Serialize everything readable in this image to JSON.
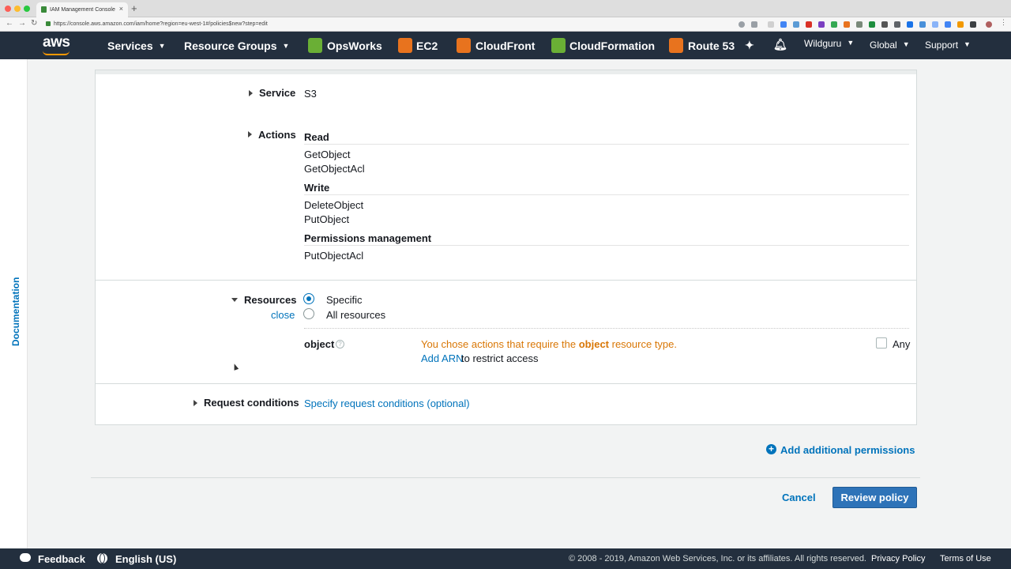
{
  "browser": {
    "tab_title": "IAM Management Console",
    "tab_close": "×",
    "new_tab": "+",
    "url": "https://console.aws.amazon.com/iam/home?region=eu-west-1#/policies$new?step=edit",
    "nav_icons": [
      "back-arrow-icon",
      "forward-arrow-icon",
      "reload-icon"
    ]
  },
  "awsnav": {
    "logo": "aws",
    "services": "Services",
    "resource_groups": "Resource Groups",
    "shortcuts": [
      {
        "label": "OpsWorks",
        "color": "#6aaf35"
      },
      {
        "label": "EC2",
        "color": "#e8731e"
      },
      {
        "label": "CloudFront",
        "color": "#e8731e"
      },
      {
        "label": "CloudFormation",
        "color": "#6aaf35"
      },
      {
        "label": "Route 53",
        "color": "#e8731e"
      }
    ],
    "account": "Wildguru",
    "region": "Global",
    "support": "Support"
  },
  "docrail": {
    "label": "Documentation"
  },
  "policy": {
    "service": {
      "label": "Service",
      "value": "S3"
    },
    "actions": {
      "label": "Actions",
      "groups": [
        {
          "name": "Read",
          "items": [
            "GetObject",
            "GetObjectAcl"
          ]
        },
        {
          "name": "Write",
          "items": [
            "DeleteObject",
            "PutObject"
          ]
        },
        {
          "name": "Permissions management",
          "items": [
            "PutObjectAcl"
          ]
        }
      ]
    },
    "resources": {
      "label": "Resources",
      "close_link": "close",
      "options": [
        {
          "label": "Specific",
          "selected": true
        },
        {
          "label": "All resources",
          "selected": false
        }
      ],
      "object": {
        "name": "object",
        "help": "?",
        "warning_pre": "You chose actions that require the ",
        "warning_bold": "object",
        "warning_post": " resource type.",
        "add_arn": "Add ARN",
        "restrict": " to restrict access",
        "any_label": "Any",
        "any_checked": false
      }
    },
    "request_conditions": {
      "label": "Request conditions",
      "link": "Specify request conditions (optional)"
    }
  },
  "actions_bar": {
    "add_permissions": "Add additional permissions",
    "cancel": "Cancel",
    "review": "Review policy"
  },
  "footer": {
    "feedback": "Feedback",
    "language": "English (US)",
    "copyright": "© 2008 - 2019, Amazon Web Services, Inc. or its affiliates. All rights reserved.",
    "privacy": "Privacy Policy",
    "terms": "Terms of Use"
  },
  "colors": {
    "nav_bg": "#232f3e",
    "link": "#0073bb",
    "warning": "#d97706",
    "primary_button": "#2e73b8",
    "aws_orange": "#ff9900"
  }
}
